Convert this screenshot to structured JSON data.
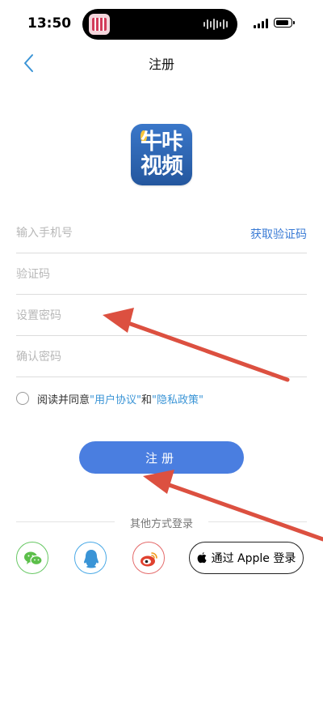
{
  "status_bar": {
    "time": "13:50"
  },
  "nav": {
    "title": "注册",
    "back_icon": "chevron-left-icon"
  },
  "logo": {
    "line1": "牛咔",
    "line2": "视频"
  },
  "form": {
    "phone_placeholder": "输入手机号",
    "get_code_label": "获取验证码",
    "code_placeholder": "验证码",
    "password_placeholder": "设置密码",
    "confirm_placeholder": "确认密码"
  },
  "agreement": {
    "prefix": "阅读并同意",
    "user_agreement": "\"用户协议\"",
    "and": "和",
    "privacy_policy": "\"隐私政策\""
  },
  "register_button": "注册",
  "other_login": {
    "label": "其他方式登录",
    "apple_label": "通过 Apple 登录",
    "icons": [
      "wechat-icon",
      "qq-icon",
      "weibo-icon",
      "apple-icon"
    ]
  },
  "colors": {
    "primary": "#4a7ee0",
    "link": "#3a94d6",
    "annotation_arrow": "#dc5040",
    "wechat": "#5cbf4a",
    "qq": "#3a94d6",
    "weibo": "#e0412f"
  }
}
